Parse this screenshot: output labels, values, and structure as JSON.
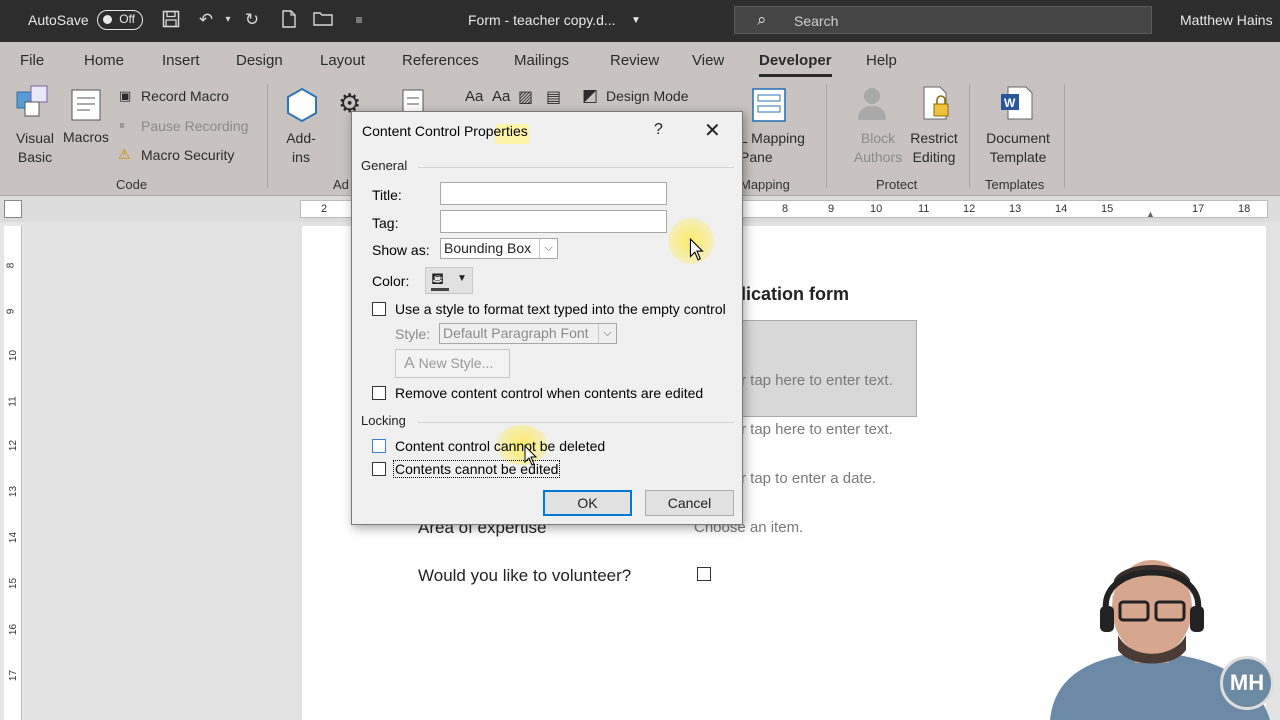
{
  "titlebar": {
    "autosave_label": "AutoSave",
    "autosave_state": "Off",
    "document_name": "Form - teacher copy.d...",
    "search_placeholder": "Search",
    "user_name": "Matthew Hains"
  },
  "ribbon": {
    "tabs": [
      "File",
      "Home",
      "Insert",
      "Design",
      "Layout",
      "References",
      "Mailings",
      "Review",
      "View",
      "Developer",
      "Help"
    ],
    "active_tab": "Developer",
    "code": {
      "visual_basic": "Visual Basic",
      "macros": "Macros",
      "record_macro": "Record Macro",
      "pause_recording": "Pause Recording",
      "macro_security": "Macro Security",
      "group_label": "Code"
    },
    "addins": {
      "label": "Add-ins",
      "group_label_partial": "Ad"
    },
    "controls": {
      "design_mode": "Design Mode"
    },
    "mapping": {
      "xml_mapping_pane": "L Mapping Pane",
      "group_label_partial": "Mapping"
    },
    "protect": {
      "block_authors": "Block Authors",
      "restrict_editing": "Restrict Editing",
      "group_label": "Protect"
    },
    "templates": {
      "document_template": "Document Template",
      "group_label": "Templates"
    }
  },
  "ruler": {
    "horizontal_numbers": [
      "2",
      "8",
      "9",
      "10",
      "11",
      "12",
      "13",
      "14",
      "15",
      "17",
      "18"
    ],
    "vertical_numbers": [
      "8",
      "9",
      "10",
      "11",
      "12",
      "13",
      "14",
      "15",
      "16",
      "17"
    ]
  },
  "document": {
    "heading_partial": "lication form",
    "placeholder_1": "r tap here to enter text.",
    "placeholder_2": "r tap here to enter text.",
    "placeholder_3": "r tap to enter a date.",
    "area_label": "Area of expertise",
    "area_value": "Choose an item.",
    "volunteer_label": "Would you like to volunteer?"
  },
  "dialog": {
    "title": "Content Control Properties",
    "help": "?",
    "close": "✕",
    "general_section": "General",
    "title_label": "Title:",
    "title_value": "",
    "tag_label": "Tag:",
    "tag_value": "",
    "show_as_label": "Show as:",
    "show_as_value": "Bounding Box",
    "color_label": "Color:",
    "use_style_label": "Use a style to format text typed into the empty control",
    "use_style_checked": false,
    "style_label": "Style:",
    "style_value": "Default Paragraph Font",
    "new_style_button": "New Style...",
    "remove_cc_label": "Remove content control when contents are edited",
    "remove_cc_checked": false,
    "locking_section": "Locking",
    "cannot_delete_label": "Content control cannot be deleted",
    "cannot_delete_checked": false,
    "cannot_edit_label": "Contents cannot be edited",
    "cannot_edit_checked": false,
    "ok_button": "OK",
    "cancel_button": "Cancel"
  },
  "overlay": {
    "logo_text": "MH"
  },
  "colors": {
    "accent": "#0078d7",
    "titlebar": "#2d2d2d",
    "ribbon": "#c8c3c0"
  }
}
